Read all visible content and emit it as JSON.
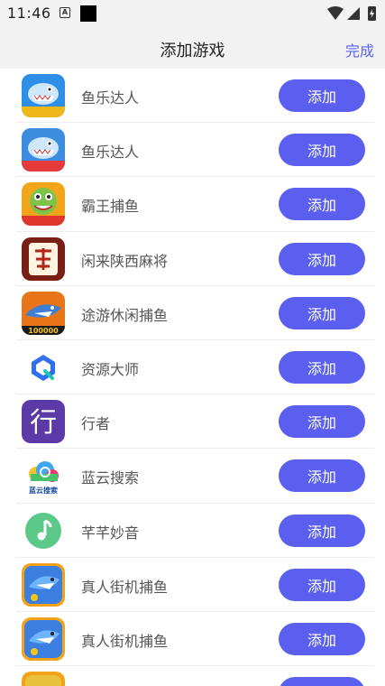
{
  "status_bar": {
    "time": "11:46",
    "badge_letter": "A"
  },
  "header": {
    "title": "添加游戏",
    "done_label": "完成"
  },
  "add_label": "添加",
  "apps": [
    {
      "name": "鱼乐达人",
      "icon": "fish-game-icon",
      "icon_text": "正版 联动"
    },
    {
      "name": "鱼乐达人",
      "icon": "fish-game-icon",
      "icon_text": "万元礼包"
    },
    {
      "name": "霸王捕鱼",
      "icon": "fish-monster-icon",
      "icon_text": "吉运岛"
    },
    {
      "name": "闲来陕西麻将",
      "icon": "mahjong-icon",
      "icon_text": "陕"
    },
    {
      "name": "途游休闲捕鱼",
      "icon": "shark-game-icon",
      "icon_text": "100000"
    },
    {
      "name": "资源大师",
      "icon": "resource-master-icon",
      "icon_text": ""
    },
    {
      "name": "行者",
      "icon": "xingzhe-icon",
      "icon_text": "行"
    },
    {
      "name": "蓝云搜索",
      "icon": "cloud-search-icon",
      "icon_text": "蓝云搜索"
    },
    {
      "name": "芊芊妙音",
      "icon": "music-note-icon",
      "icon_text": ""
    },
    {
      "name": "真人街机捕鱼",
      "icon": "arcade-shark-icon",
      "icon_text": ""
    },
    {
      "name": "真人街机捕鱼",
      "icon": "arcade-shark-icon",
      "icon_text": ""
    },
    {
      "name": "",
      "icon": "partial-game-icon",
      "icon_text": ""
    }
  ],
  "colors": {
    "accent": "#5a5ff0",
    "header_bg": "#f2f2f2",
    "divider": "#ececec"
  }
}
